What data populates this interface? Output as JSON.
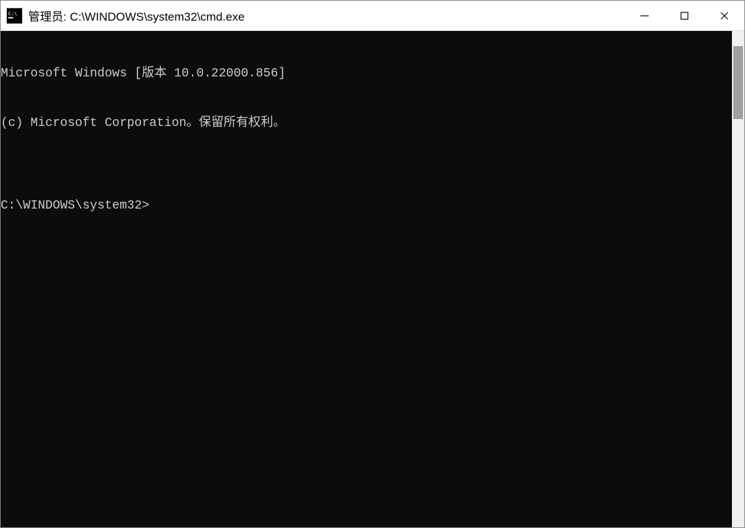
{
  "titlebar": {
    "title": "管理员: C:\\WINDOWS\\system32\\cmd.exe"
  },
  "terminal": {
    "line1": "Microsoft Windows [版本 10.0.22000.856]",
    "line2": "(c) Microsoft Corporation。保留所有权利。",
    "blank": "",
    "prompt": "C:\\WINDOWS\\system32>"
  }
}
